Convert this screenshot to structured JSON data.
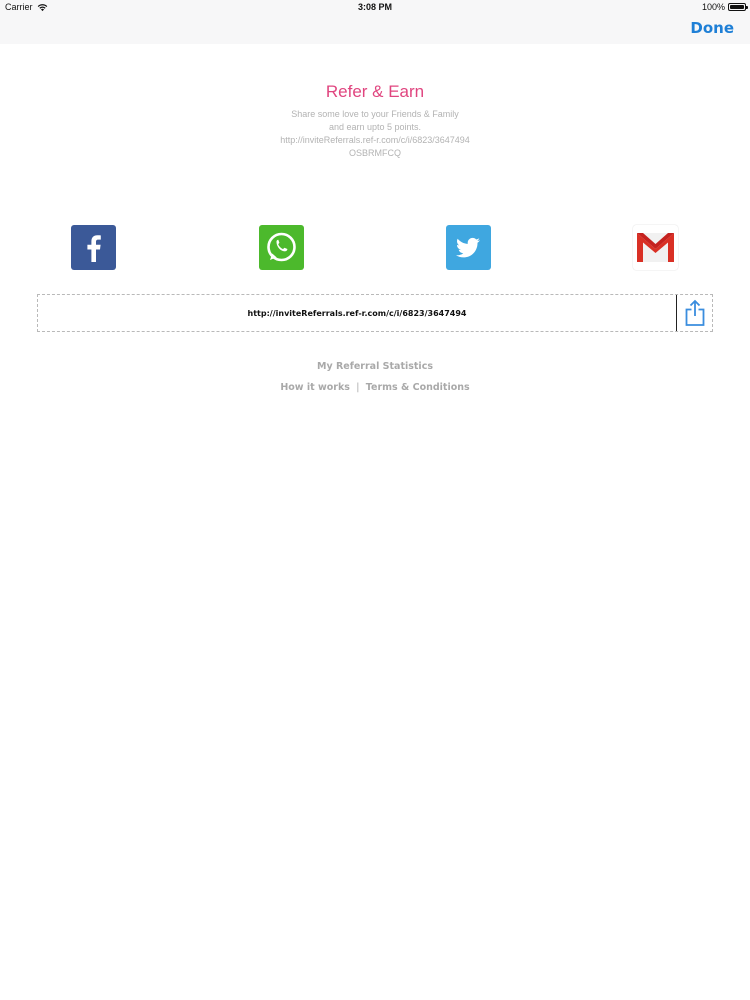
{
  "status": {
    "carrier": "Carrier",
    "time": "3:08 PM",
    "battery": "100%"
  },
  "nav": {
    "done_label": "Done"
  },
  "header": {
    "title": "Refer & Earn",
    "line1": "Share some love to your Friends & Family",
    "line2": "and earn upto 5 points.",
    "line3": "http://inviteReferrals.ref-r.com/c/i/6823/3647494",
    "line4": "OSBRMFCQ"
  },
  "share": {
    "icons": [
      "facebook-icon",
      "whatsapp-icon",
      "twitter-icon",
      "gmail-icon"
    ],
    "colors": {
      "facebook": "#3b5998",
      "whatsapp": "#4cb92c",
      "twitter": "#3fa7e0",
      "gmail": "#d93025"
    }
  },
  "link_box": {
    "url": "http://inviteReferrals.ref-r.com/c/i/6823/3647494"
  },
  "links": {
    "statistics": "My Referral Statistics",
    "how_it_works": "How it works",
    "separator": "|",
    "terms": "Terms & Conditions"
  },
  "colors": {
    "accent": "#1e7fd6",
    "title": "#e0457f"
  }
}
